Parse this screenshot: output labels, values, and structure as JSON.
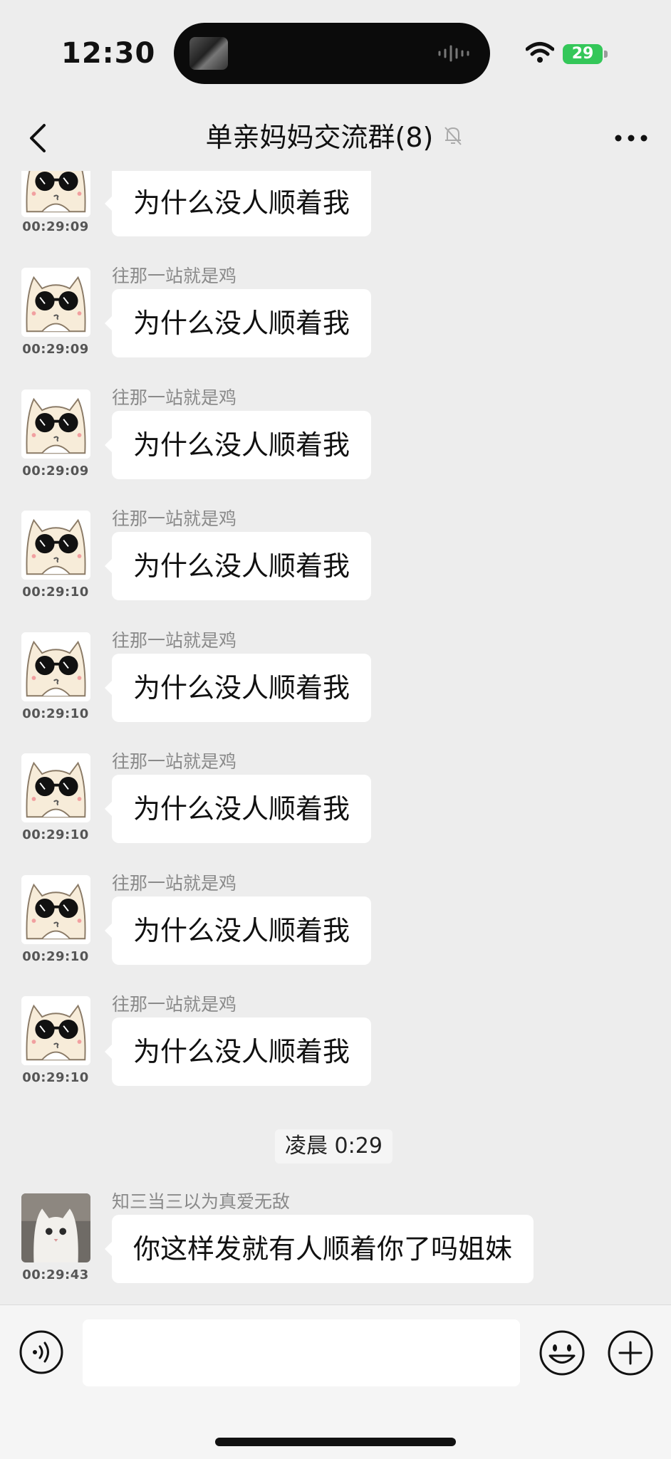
{
  "status_bar": {
    "time": "12:30",
    "battery": "29"
  },
  "nav": {
    "title": "单亲妈妈交流群(8)"
  },
  "first_partial": {
    "text": "为什么没人顺着我",
    "time": "00:29:09"
  },
  "messages": [
    {
      "nick": "往那一站就是鸡",
      "text": "为什么没人顺着我",
      "time": "00:29:09"
    },
    {
      "nick": "往那一站就是鸡",
      "text": "为什么没人顺着我",
      "time": "00:29:09"
    },
    {
      "nick": "往那一站就是鸡",
      "text": "为什么没人顺着我",
      "time": "00:29:10"
    },
    {
      "nick": "往那一站就是鸡",
      "text": "为什么没人顺着我",
      "time": "00:29:10"
    },
    {
      "nick": "往那一站就是鸡",
      "text": "为什么没人顺着我",
      "time": "00:29:10"
    },
    {
      "nick": "往那一站就是鸡",
      "text": "为什么没人顺着我",
      "time": "00:29:10"
    },
    {
      "nick": "往那一站就是鸡",
      "text": "为什么没人顺着我",
      "time": "00:29:10"
    }
  ],
  "system_time": "凌晨 0:29",
  "last_message": {
    "nick": "知三当三以为真爱无敌",
    "text": "你这样发就有人顺着你了吗姐妹",
    "time": "00:29:43"
  },
  "icons": {
    "back": "chevron-left-icon",
    "mute": "bell-slash-icon",
    "more": "more-dots-icon",
    "voice": "voice-icon",
    "emoji": "emoji-icon",
    "plus": "plus-icon"
  }
}
